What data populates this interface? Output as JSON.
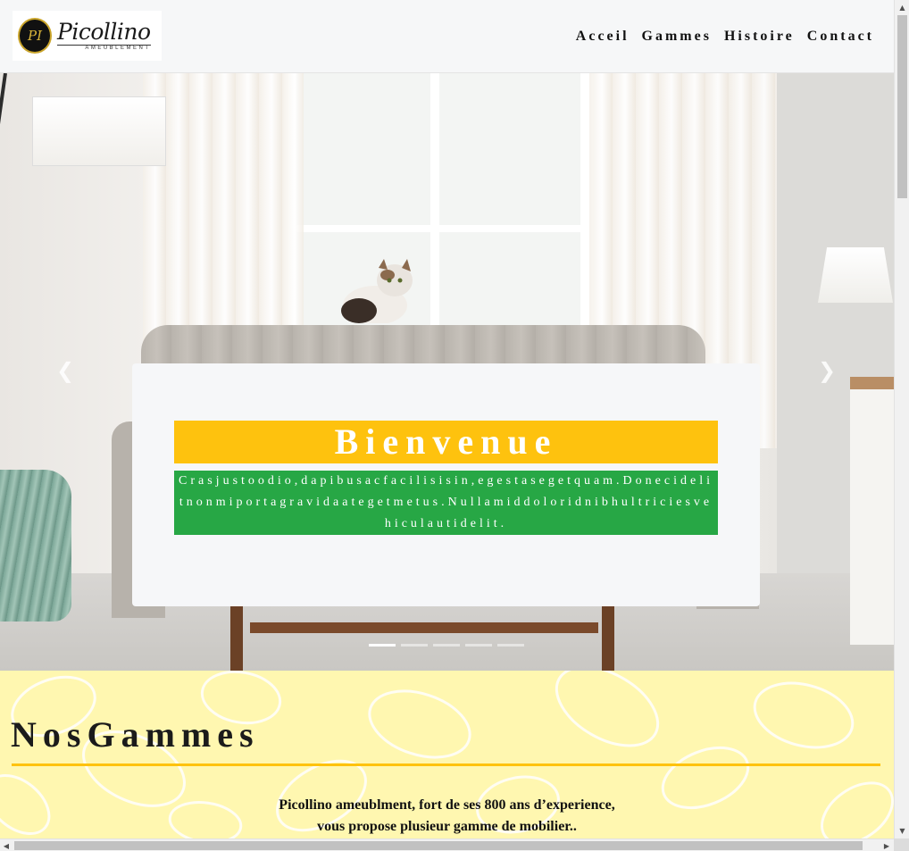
{
  "brand": {
    "name": "Picollino",
    "tagline": "AMEUBLEMENT",
    "emblem": "PI"
  },
  "nav": {
    "items": [
      {
        "label": "Acceil"
      },
      {
        "label": "Gammes"
      },
      {
        "label": "Histoire"
      },
      {
        "label": "Contact"
      }
    ]
  },
  "hero": {
    "prev_icon": "chevron-left-icon",
    "next_icon": "chevron-right-icon",
    "title": "Bienvenue",
    "text": "Crasjustoodio,dapibusacfacilisisin,egestasegetquam.Donecidelitnonmiportagravidaategetmetus.Nullamiddoloridnibhultriciesvehiculautidelit.",
    "slide_count": 5,
    "active_slide": 1
  },
  "gammes": {
    "title": "NosGammes",
    "desc_line1": "Picollino ameublment, fort de ses 800 ans d’experience,",
    "desc_line2": "vous propose plusieur gamme de mobilier.."
  },
  "colors": {
    "accent_yellow": "#fec20e",
    "accent_green": "#27a745",
    "section_bg": "#fff7b0",
    "header_bg": "#f6f7f8"
  }
}
